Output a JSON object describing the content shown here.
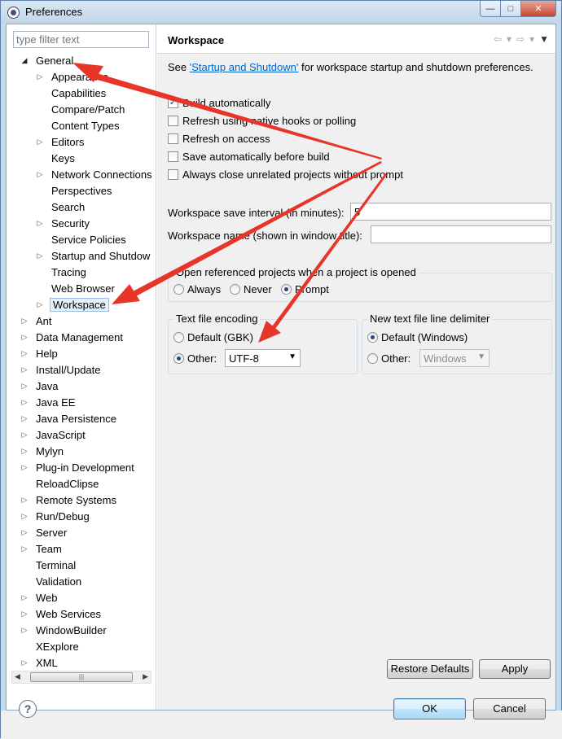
{
  "window": {
    "title": "Preferences",
    "controls": {
      "minimize": "—",
      "maximize": "□",
      "close": "✕"
    }
  },
  "filter": {
    "placeholder": "type filter text"
  },
  "tree": {
    "items": [
      {
        "label": "General",
        "expander": "◢",
        "level": 0
      },
      {
        "label": "Appearance",
        "expander": "▷",
        "level": 1
      },
      {
        "label": "Capabilities",
        "expander": "",
        "level": 1
      },
      {
        "label": "Compare/Patch",
        "expander": "",
        "level": 1
      },
      {
        "label": "Content Types",
        "expander": "",
        "level": 1
      },
      {
        "label": "Editors",
        "expander": "▷",
        "level": 1
      },
      {
        "label": "Keys",
        "expander": "",
        "level": 1
      },
      {
        "label": "Network Connections",
        "expander": "▷",
        "level": 1
      },
      {
        "label": "Perspectives",
        "expander": "",
        "level": 1
      },
      {
        "label": "Search",
        "expander": "",
        "level": 1
      },
      {
        "label": "Security",
        "expander": "▷",
        "level": 1
      },
      {
        "label": "Service Policies",
        "expander": "",
        "level": 1
      },
      {
        "label": "Startup and Shutdow",
        "expander": "▷",
        "level": 1
      },
      {
        "label": "Tracing",
        "expander": "",
        "level": 1
      },
      {
        "label": "Web Browser",
        "expander": "",
        "level": 1
      },
      {
        "label": "Workspace",
        "expander": "▷",
        "level": 1,
        "selected": true
      },
      {
        "label": "Ant",
        "expander": "▷",
        "level": 0
      },
      {
        "label": "Data Management",
        "expander": "▷",
        "level": 0
      },
      {
        "label": "Help",
        "expander": "▷",
        "level": 0
      },
      {
        "label": "Install/Update",
        "expander": "▷",
        "level": 0
      },
      {
        "label": "Java",
        "expander": "▷",
        "level": 0
      },
      {
        "label": "Java EE",
        "expander": "▷",
        "level": 0
      },
      {
        "label": "Java Persistence",
        "expander": "▷",
        "level": 0
      },
      {
        "label": "JavaScript",
        "expander": "▷",
        "level": 0
      },
      {
        "label": "Mylyn",
        "expander": "▷",
        "level": 0
      },
      {
        "label": "Plug-in Development",
        "expander": "▷",
        "level": 0
      },
      {
        "label": "ReloadClipse",
        "expander": "",
        "level": 0
      },
      {
        "label": "Remote Systems",
        "expander": "▷",
        "level": 0
      },
      {
        "label": "Run/Debug",
        "expander": "▷",
        "level": 0
      },
      {
        "label": "Server",
        "expander": "▷",
        "level": 0
      },
      {
        "label": "Team",
        "expander": "▷",
        "level": 0
      },
      {
        "label": "Terminal",
        "expander": "",
        "level": 0
      },
      {
        "label": "Validation",
        "expander": "",
        "level": 0
      },
      {
        "label": "Web",
        "expander": "▷",
        "level": 0
      },
      {
        "label": "Web Services",
        "expander": "▷",
        "level": 0
      },
      {
        "label": "WindowBuilder",
        "expander": "▷",
        "level": 0
      },
      {
        "label": "XExplore",
        "expander": "",
        "level": 0
      },
      {
        "label": "XML",
        "expander": "▷",
        "level": 0
      }
    ],
    "scroll_thumb_grip": "|||",
    "scroll_left": "◀",
    "scroll_right": "▶"
  },
  "page": {
    "title": "Workspace",
    "nav": {
      "back": "⇦",
      "back_menu": "▾",
      "forward": "⇨",
      "forward_menu": "▾",
      "view_menu": "▼"
    },
    "info_prefix": "See ",
    "info_link": "'Startup and Shutdown'",
    "info_suffix": " for workspace startup and shutdown preferences.",
    "checkboxes": [
      {
        "label": "Build automatically",
        "checked": true
      },
      {
        "label": "Refresh using native hooks or polling",
        "checked": false
      },
      {
        "label": "Refresh on access",
        "checked": false
      },
      {
        "label": "Save automatically before build",
        "checked": false
      },
      {
        "label": "Always close unrelated projects without prompt",
        "checked": false
      }
    ],
    "save_interval_label": "Workspace save interval (in minutes):",
    "save_interval_value": "5",
    "workspace_name_label": "Workspace name (shown in window title):",
    "workspace_name_value": "",
    "open_referenced": {
      "label": "Open referenced projects when a project is opened",
      "options": [
        "Always",
        "Never",
        "Prompt"
      ],
      "selected": "Prompt"
    },
    "encoding": {
      "label": "Text file encoding",
      "default_option": "Default (GBK)",
      "other_option": "Other:",
      "other_value": "UTF-8",
      "selected": "Other"
    },
    "line_delimiter": {
      "label": "New text file line delimiter",
      "default_option": "Default (Windows)",
      "other_option": "Other:",
      "other_value": "Windows",
      "selected": "Default"
    },
    "restore_defaults": "Restore Defaults",
    "apply": "Apply"
  },
  "footer": {
    "help": "?",
    "ok": "OK",
    "cancel": "Cancel"
  },
  "colors": {
    "annotation_arrow": "#e8352a",
    "link": "#0066cc",
    "selection_border": "#99bde6"
  }
}
